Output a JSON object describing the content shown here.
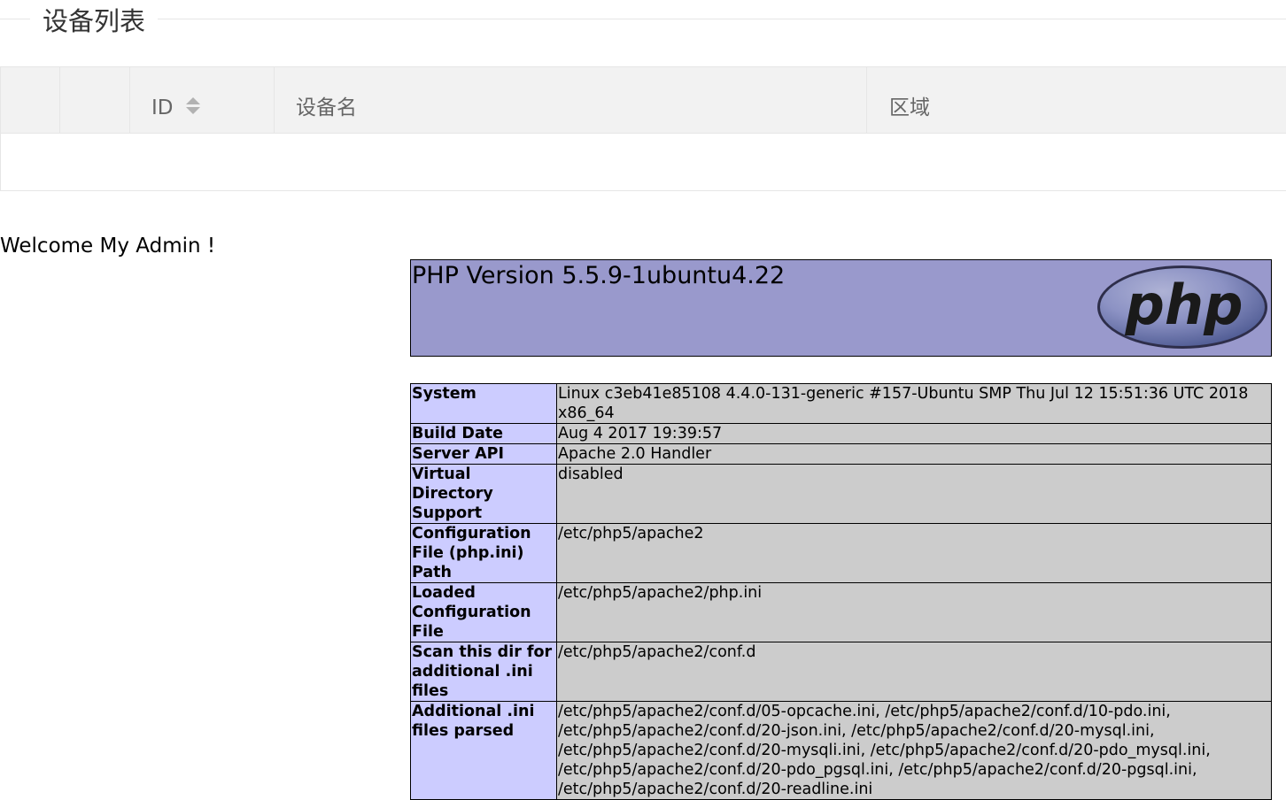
{
  "legend": {
    "title": "设备列表"
  },
  "table": {
    "columns": [
      {
        "label": ""
      },
      {
        "label": ""
      },
      {
        "label": "ID",
        "sortable": true
      },
      {
        "label": "设备名"
      },
      {
        "label": "区域"
      }
    ],
    "rows": []
  },
  "welcome": "Welcome My Admin !",
  "phpinfo": {
    "title": "PHP Version 5.5.9-1ubuntu4.22",
    "logo_text": "php",
    "colors": {
      "header_bg": "#9999cc",
      "key_bg": "#ccccff",
      "value_bg": "#cccccc"
    },
    "rows": [
      {
        "key": "System",
        "value": "Linux c3eb41e85108 4.4.0-131-generic #157-Ubuntu SMP Thu Jul 12 15:51:36 UTC 2018 x86_64"
      },
      {
        "key": "Build Date",
        "value": "Aug 4 2017 19:39:57"
      },
      {
        "key": "Server API",
        "value": "Apache 2.0 Handler"
      },
      {
        "key": "Virtual Directory Support",
        "value": "disabled"
      },
      {
        "key": "Configuration File (php.ini) Path",
        "value": "/etc/php5/apache2"
      },
      {
        "key": "Loaded Configuration File",
        "value": "/etc/php5/apache2/php.ini"
      },
      {
        "key": "Scan this dir for additional .ini files",
        "value": "/etc/php5/apache2/conf.d"
      },
      {
        "key": "Additional .ini files parsed",
        "value": "/etc/php5/apache2/conf.d/05-opcache.ini, /etc/php5/apache2/conf.d/10-pdo.ini, /etc/php5/apache2/conf.d/20-json.ini, /etc/php5/apache2/conf.d/20-mysql.ini, /etc/php5/apache2/conf.d/20-mysqli.ini, /etc/php5/apache2/conf.d/20-pdo_mysql.ini, /etc/php5/apache2/conf.d/20-pdo_pgsql.ini, /etc/php5/apache2/conf.d/20-pgsql.ini, /etc/php5/apache2/conf.d/20-readline.ini"
      }
    ]
  }
}
